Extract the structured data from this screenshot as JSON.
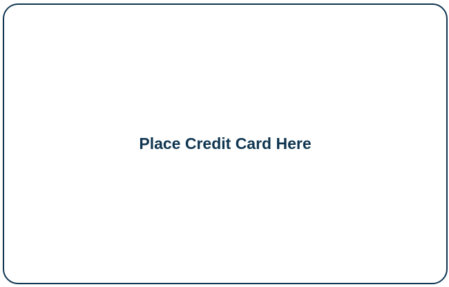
{
  "card_placeholder": {
    "label": "Place Credit Card Here"
  },
  "colors": {
    "border": "#0f3550",
    "text": "#0f3550",
    "background": "#ffffff"
  }
}
